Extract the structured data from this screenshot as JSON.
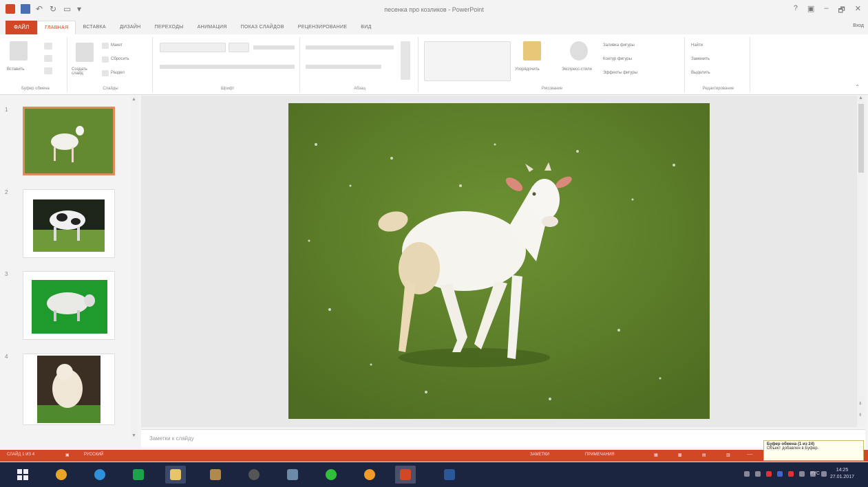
{
  "window": {
    "title": "песенка про козликов - PowerPoint",
    "controls": [
      "?",
      "▣",
      "–",
      "🗗",
      "✕"
    ]
  },
  "tabs": {
    "file": "ФАЙЛ",
    "items": [
      "ГЛАВНАЯ",
      "ВСТАВКА",
      "ДИЗАЙН",
      "ПЕРЕХОДЫ",
      "АНИМАЦИЯ",
      "ПОКАЗ СЛАЙДОВ",
      "РЕЦЕНЗИРОВАНИЕ",
      "ВИД"
    ],
    "active_index": 0,
    "signin": "Вход"
  },
  "ribbon": {
    "clipboard": {
      "label": "Буфер обмена",
      "paste": "Вставить"
    },
    "slides": {
      "label": "Слайды",
      "new_slide": "Создать слайд",
      "layout": "Макет",
      "reset": "Сбросить",
      "section": "Раздел"
    },
    "font": {
      "label": "Шрифт"
    },
    "paragraph": {
      "label": "Абзац"
    },
    "drawing": {
      "label": "Рисование",
      "arrange": "Упорядочить",
      "quick_styles": "Экспресс-стили",
      "fill": "Заливка фигуры",
      "outline": "Контур фигуры",
      "effects": "Эффекты фигуры"
    },
    "editing": {
      "label": "Редактирование",
      "find": "Найти",
      "replace": "Заменить",
      "select": "Выделить"
    }
  },
  "thumbnails": [
    {
      "number": "1",
      "subject": "goat",
      "selected": true
    },
    {
      "number": "2",
      "subject": "cow",
      "selected": false
    },
    {
      "number": "3",
      "subject": "sheep",
      "selected": false
    },
    {
      "number": "4",
      "subject": "dog",
      "selected": false
    }
  ],
  "notes": {
    "placeholder": "Заметки к слайду"
  },
  "status": {
    "slide_info": "СЛАЙД 1 ИЗ 4",
    "language": "РУССКИЙ",
    "notes_btn": "ЗАМЕТКИ",
    "comments_btn": "ПРИМЕЧАНИЯ"
  },
  "clipboard_tip": {
    "title": "Буфер обмена (1 из 24)",
    "body": "Объект добавлен в Буфер."
  },
  "taskbar": {
    "apps": [
      "start",
      "chrome",
      "ie",
      "store",
      "explorer",
      "app5",
      "app6",
      "app7",
      "app8",
      "app9",
      "powerpoint",
      "word"
    ],
    "lang": "РУС",
    "time": "14:25",
    "date": "27.01.2017"
  },
  "colors": {
    "accent": "#d24726",
    "taskbar": "#1c2540"
  }
}
